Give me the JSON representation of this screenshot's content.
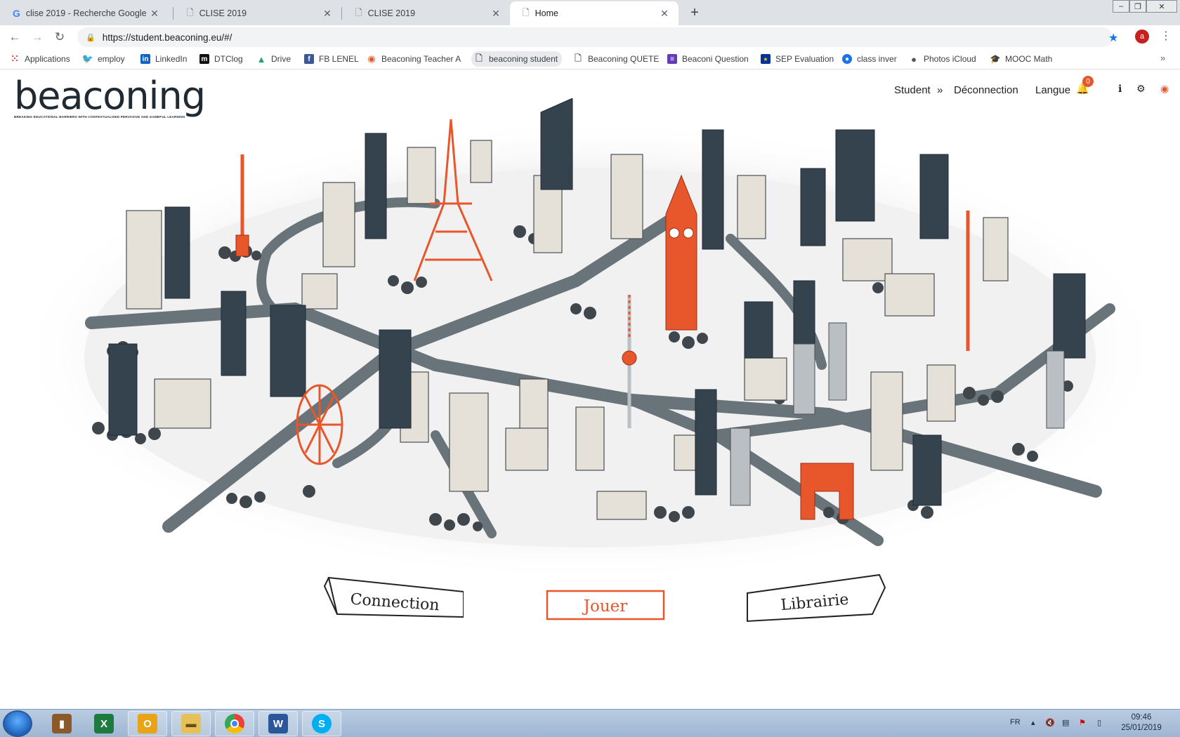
{
  "browser": {
    "tabs": [
      {
        "title": "clise 2019 - Recherche Google",
        "icon": "google-g-icon",
        "active": false
      },
      {
        "title": "CLISE 2019",
        "icon": "page-icon",
        "active": false
      },
      {
        "title": "CLISE 2019",
        "icon": "page-icon",
        "active": false
      },
      {
        "title": "Home",
        "icon": "page-icon",
        "active": true
      }
    ],
    "new_tab": "+",
    "url": "https://student.beaconing.eu/#/",
    "profile_initial": "a",
    "bookmarks": [
      {
        "label": "Applications",
        "icon": "apps-grid-icon",
        "color": "#ea4335"
      },
      {
        "label": "employ",
        "icon": "twitter-icon",
        "color": "#1da1f2"
      },
      {
        "label": "LinkedIn",
        "icon": "linkedin-icon",
        "color": "#0a66c2"
      },
      {
        "label": "DTClog",
        "icon": "m-logo-icon",
        "color": "#111111"
      },
      {
        "label": "Drive",
        "icon": "google-drive-icon",
        "color": "#1fa463"
      },
      {
        "label": "FB LENEL",
        "icon": "facebook-icon",
        "color": "#3b5998"
      },
      {
        "label": "Beaconing Teacher A",
        "icon": "beacon-icon",
        "color": "#e8562b"
      },
      {
        "label": "beaconing student",
        "icon": "page-icon",
        "color": "#5f6368"
      },
      {
        "label": "Beaconing QUETE",
        "icon": "page-icon",
        "color": "#5f6368"
      },
      {
        "label": "Beaconi Question",
        "icon": "form-icon",
        "color": "#673ab7"
      },
      {
        "label": "SEP Evaluation",
        "icon": "eu-flag-icon",
        "color": "#003399"
      },
      {
        "label": "class inver",
        "icon": "globe-icon",
        "color": "#1a73e8"
      },
      {
        "label": "Photos iCloud",
        "icon": "apple-icon",
        "color": "#555555"
      },
      {
        "label": "MOOC Math",
        "icon": "mortarboard-icon",
        "color": "#333333"
      }
    ]
  },
  "site": {
    "logo_text": "beaconing",
    "logo_tagline": "BREAKING EDUCATIONAL BARRIERS WITH CONTEXTUALISED PERVASIVE AND GAMEFUL LEARNING",
    "nav": {
      "student": "Student",
      "separator": "»",
      "logout": "Déconnection",
      "language": "Langue"
    },
    "notifications_count": "0",
    "buttons": {
      "connection": "Connection",
      "play": "Jouer",
      "library": "Librairie"
    },
    "colors": {
      "accent": "#e8562b",
      "dark": "#1f2a33",
      "building_light": "#e6e1d8",
      "building_dark": "#34434d",
      "road": "#69737a"
    }
  },
  "taskbar": {
    "apps": [
      {
        "name": "library-books-icon",
        "color": "#8b5a2b"
      },
      {
        "name": "excel-icon",
        "label": "X",
        "color": "#1f7a3f"
      },
      {
        "name": "outlook-icon",
        "label": "O",
        "color": "#e8a317"
      },
      {
        "name": "file-explorer-icon",
        "color": "#e6c15a"
      },
      {
        "name": "chrome-icon",
        "color": "#4285f4"
      },
      {
        "name": "word-icon",
        "label": "W",
        "color": "#2b579a"
      },
      {
        "name": "skype-icon",
        "label": "S",
        "color": "#00aff0"
      }
    ],
    "language": "FR",
    "time": "09:46",
    "date": "25/01/2019"
  }
}
